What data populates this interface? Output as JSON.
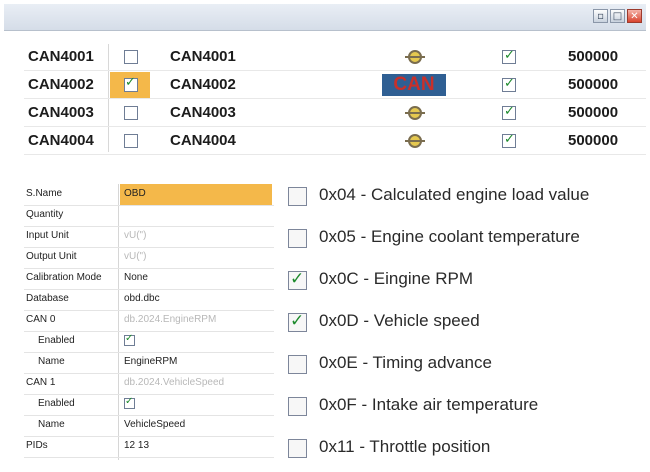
{
  "window": {
    "min_glyph": "▫",
    "max_glyph": "□",
    "close_glyph": "✕"
  },
  "can_list": [
    {
      "name": "CAN4001",
      "checked": false,
      "label": "CAN4001",
      "active": false,
      "enabled": true,
      "baud": "500000"
    },
    {
      "name": "CAN4002",
      "checked": true,
      "label": "CAN4002",
      "active": true,
      "enabled": true,
      "baud": "500000"
    },
    {
      "name": "CAN4003",
      "checked": false,
      "label": "CAN4003",
      "active": false,
      "enabled": true,
      "baud": "500000"
    },
    {
      "name": "CAN4004",
      "checked": false,
      "label": "CAN4004",
      "active": false,
      "enabled": true,
      "baud": "500000"
    }
  ],
  "can_badge": "CAN",
  "check_glyph": "✓",
  "properties": {
    "sname": {
      "key": "S.Name",
      "value": "OBD"
    },
    "quantity": {
      "key": "Quantity",
      "value": ""
    },
    "input_unit": {
      "key": "Input Unit",
      "value": "vU(\")"
    },
    "output_unit": {
      "key": "Output Unit",
      "value": "vU(\")"
    },
    "calibration": {
      "key": "Calibration Mode",
      "value": "None"
    },
    "database": {
      "key": "Database",
      "value": "obd.dbc"
    },
    "can0": {
      "key": "CAN 0",
      "value": "db.2024.EngineRPM"
    },
    "can0_enabled": {
      "key": "Enabled",
      "checked": true
    },
    "can0_name": {
      "key": "Name",
      "value": "EngineRPM"
    },
    "can1": {
      "key": "CAN 1",
      "value": "db.2024.VehicleSpeed"
    },
    "can1_enabled": {
      "key": "Enabled",
      "checked": true
    },
    "can1_name": {
      "key": "Name",
      "value": "VehicleSpeed"
    },
    "pids": {
      "key": "PIDs",
      "value": "12 13"
    }
  },
  "pid_list": [
    {
      "label": "0x04 - Calculated engine load value",
      "checked": false
    },
    {
      "label": "0x05 - Engine coolant temperature",
      "checked": false
    },
    {
      "label": "0x0C - Eingine RPM",
      "checked": true
    },
    {
      "label": "0x0D - Vehicle speed",
      "checked": true
    },
    {
      "label": "0x0E - Timing advance",
      "checked": false
    },
    {
      "label": "0x0F - Intake air temperature",
      "checked": false
    },
    {
      "label": "0x11 - Throttle position",
      "checked": false
    }
  ],
  "colors": {
    "highlight": "#f4b84a",
    "check": "#1d8a2c",
    "can_badge_bg": "#2f5f93",
    "can_badge_fg": "#c8302a"
  }
}
